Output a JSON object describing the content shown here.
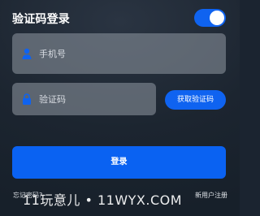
{
  "header": {
    "title": "验证码登录",
    "toggle_on": true,
    "toggle_icon": "toggle-switch"
  },
  "form": {
    "phone": {
      "placeholder": "手机号",
      "icon": "user-icon"
    },
    "code": {
      "placeholder": "验证码",
      "icon": "lock-icon"
    },
    "get_code_label": "获取验证码",
    "submit_label": "登录"
  },
  "footer": {
    "forgot_label": "忘记密码?",
    "register_label": "新用户注册"
  },
  "watermark": "11玩意儿 • 11WYX.COM",
  "colors": {
    "accent": "#0f63f0",
    "field_bg": "#8a919a",
    "text": "#ffffff"
  }
}
